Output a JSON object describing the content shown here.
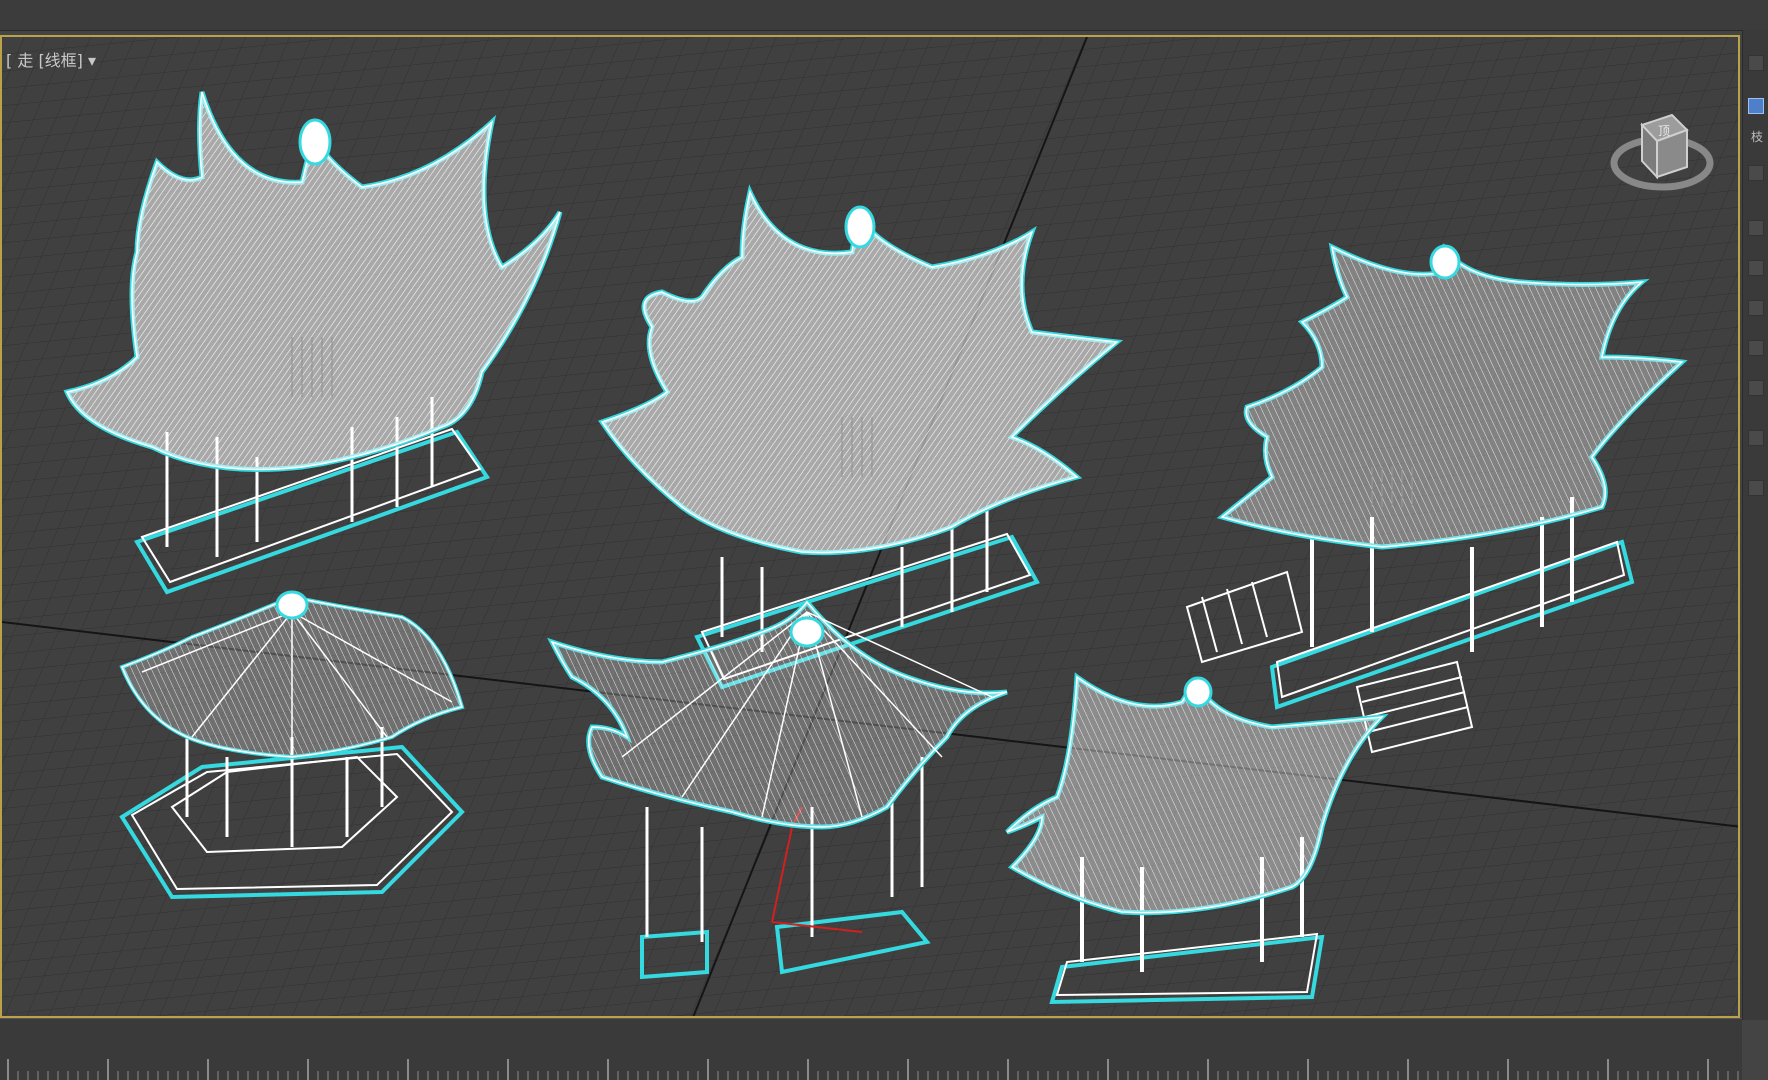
{
  "viewport": {
    "label_prefix": "[ ",
    "view_mode_fragment": "走",
    "render_mode": "[线框]",
    "menu_arrow": "▾"
  },
  "viewcube": {
    "icon": "viewcube-icon",
    "face_label": "顶"
  },
  "right_panel": {
    "items": [
      "panel-tab",
      "panel-tab-active",
      "panel-tab"
    ],
    "fragment_text": "枝"
  },
  "colors": {
    "background": "#404040",
    "grid": "#2f2f2f",
    "wire": "#f4f6f6",
    "selection": "#35d9e0",
    "viewport_border": "#b9a24a"
  },
  "models": [
    {
      "name": "pavilion-1",
      "kind": "double-eave hexagonal pavilion"
    },
    {
      "name": "pavilion-2",
      "kind": "double-eave hexagonal pavilion"
    },
    {
      "name": "pavilion-3",
      "kind": "square double-roof pavilion with steps"
    },
    {
      "name": "pavilion-4",
      "kind": "hexagonal pavilion with bench"
    },
    {
      "name": "pavilion-5",
      "kind": "hexagonal pavilion"
    },
    {
      "name": "pavilion-6",
      "kind": "square pavilion"
    }
  ]
}
